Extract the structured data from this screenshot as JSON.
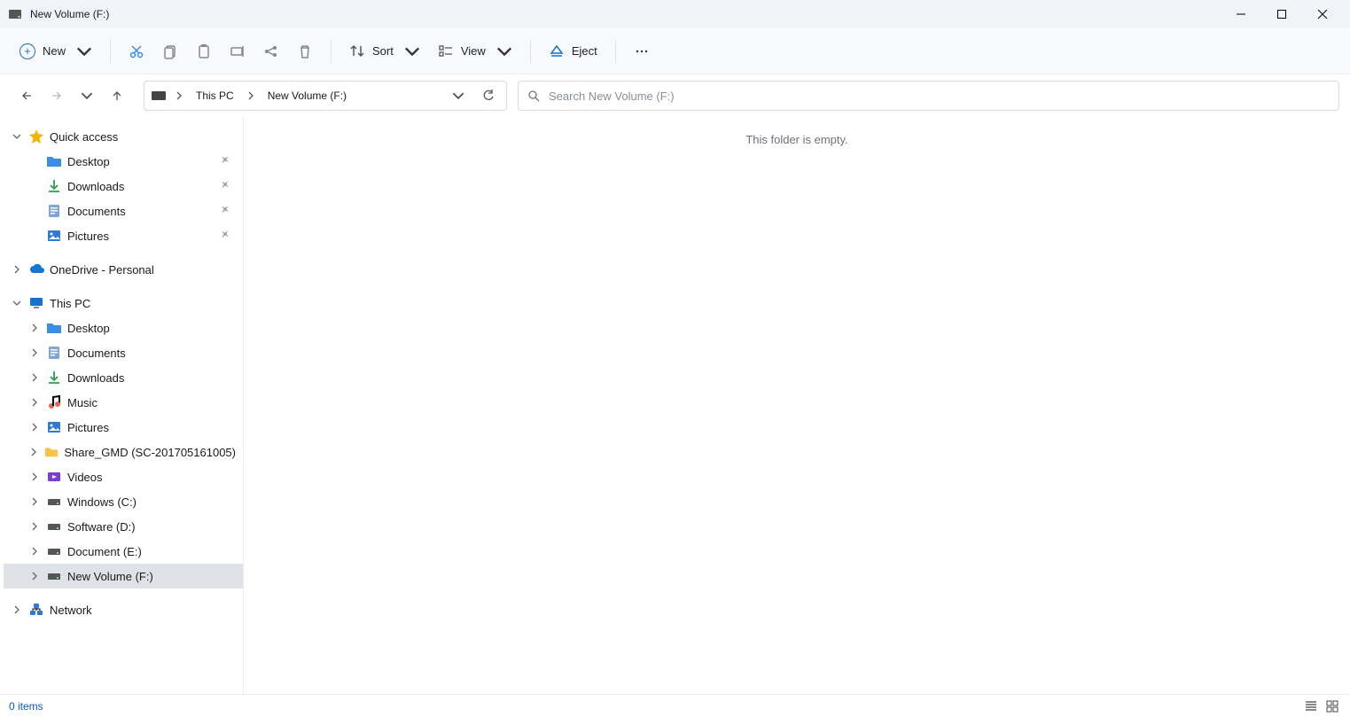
{
  "window": {
    "title": "New Volume (F:)"
  },
  "toolbar": {
    "new_label": "New",
    "sort_label": "Sort",
    "view_label": "View",
    "eject_label": "Eject"
  },
  "address": {
    "seg1": "This PC",
    "seg2": "New Volume (F:)"
  },
  "search": {
    "placeholder": "Search New Volume (F:)"
  },
  "sidebar": {
    "quick_access": "Quick access",
    "qa_items": [
      {
        "label": "Desktop"
      },
      {
        "label": "Downloads"
      },
      {
        "label": "Documents"
      },
      {
        "label": "Pictures"
      }
    ],
    "onedrive": "OneDrive - Personal",
    "this_pc": "This PC",
    "pc_items": [
      {
        "label": "Desktop"
      },
      {
        "label": "Documents"
      },
      {
        "label": "Downloads"
      },
      {
        "label": "Music"
      },
      {
        "label": "Pictures"
      },
      {
        "label": "Share_GMD (SC-201705161005)"
      },
      {
        "label": "Videos"
      },
      {
        "label": "Windows (C:)"
      },
      {
        "label": "Software (D:)"
      },
      {
        "label": "Document (E:)"
      },
      {
        "label": "New Volume (F:)"
      }
    ],
    "network": "Network"
  },
  "content": {
    "empty_message": "This folder is empty."
  },
  "status": {
    "item_count": "0 items"
  }
}
